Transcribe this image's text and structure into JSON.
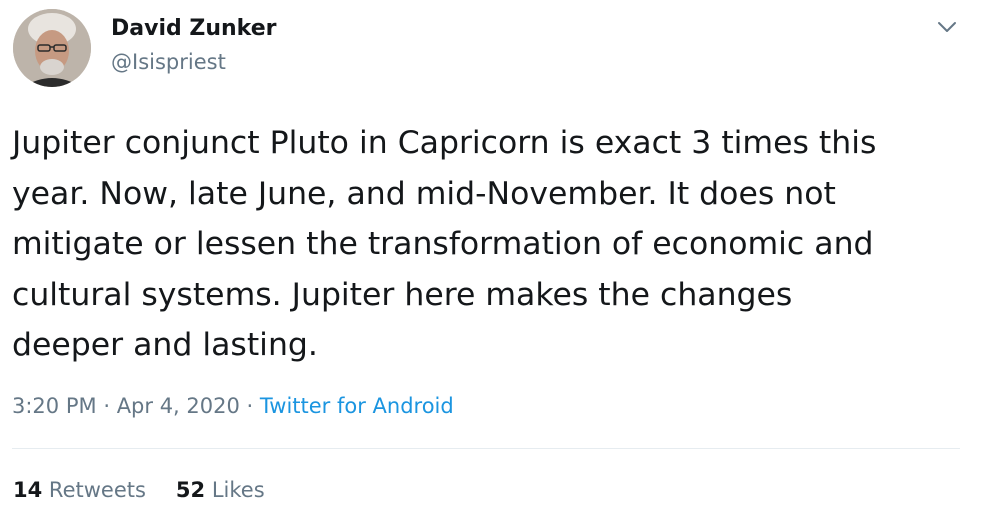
{
  "author": {
    "name": "David Zunker",
    "handle": "@Isispriest"
  },
  "tweet": {
    "lines": [
      "Jupiter conjunct Pluto in Capricorn is exact 3 times this",
      "year. Now, late June, and mid-November. It does not",
      "mitigate or lessen the transformation of economic and",
      "cultural systems. Jupiter here makes the changes",
      "deeper and lasting."
    ]
  },
  "meta": {
    "time": "3:20 PM",
    "separator1": "·",
    "date": "Apr 4, 2020",
    "separator2": "·",
    "source": "Twitter for Android"
  },
  "stats": {
    "retweets_count": "14",
    "retweets_label": "Retweets",
    "likes_count": "52",
    "likes_label": "Likes"
  },
  "icons": {
    "menu": "chevron-down-icon"
  },
  "colors": {
    "text": "#14171a",
    "secondary": "#657786",
    "link": "#1b95e0",
    "divider": "#e6ecf0"
  }
}
